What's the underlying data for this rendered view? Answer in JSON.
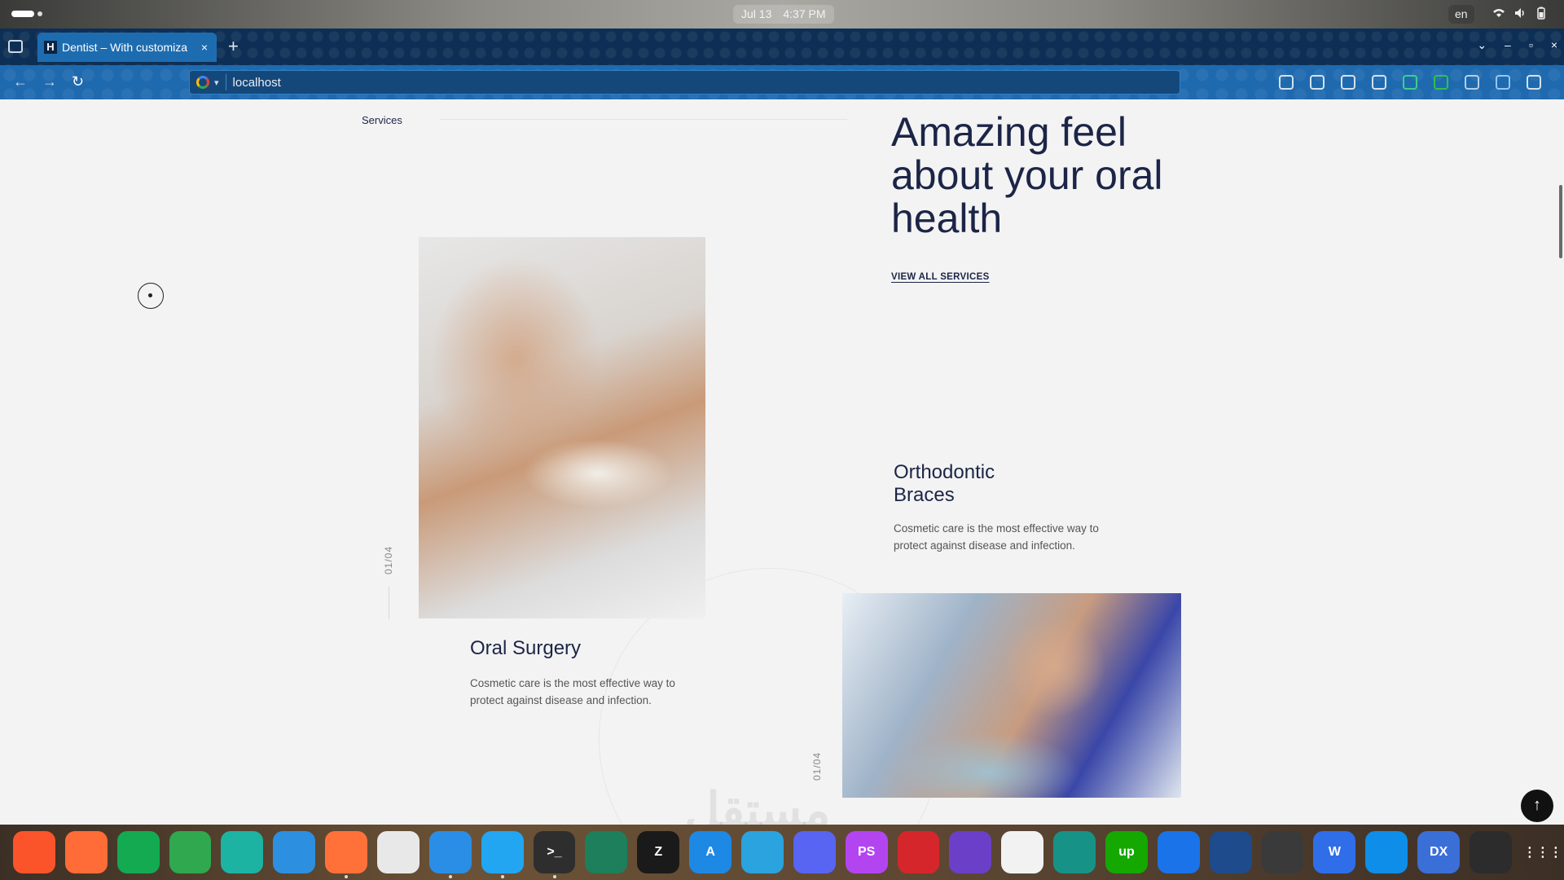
{
  "os": {
    "date": "Jul 13",
    "time": "4:37 PM",
    "language": "en",
    "tray_icons": [
      "wifi-icon",
      "volume-icon",
      "battery-icon"
    ]
  },
  "browser": {
    "tab_title": "Dentist – With customiza",
    "tab_favicon": "H",
    "tab_close": "×",
    "new_tab": "+",
    "url": "localhost",
    "back": "←",
    "forward": "→",
    "reload": "↻",
    "window_controls": {
      "minimize": "–",
      "maximize": "▫",
      "close": "×"
    },
    "tab_list": "⌄",
    "extension_colors": [
      "#e8eef5",
      "#e8eef5",
      "#e8eef5",
      "#e8eef5",
      "#3ddc84",
      "#2ecc40",
      "#c8d8e8",
      "#a0d0ff",
      "#e8eef5"
    ]
  },
  "page": {
    "breadcrumb": "Services",
    "hero_title": "Amazing feel about your oral health",
    "view_all": "VIEW ALL SERVICES",
    "services": [
      {
        "counter": "01/04",
        "title": "Oral Surgery",
        "description": "Cosmetic care is the most effective way to protect against disease and infection."
      },
      {
        "counter": "01/04",
        "title": "Orthodontic Braces",
        "description": "Cosmetic care is the most effective way to protect against disease and infection."
      }
    ],
    "back_to_top": "↑",
    "watermark": "مستقل"
  },
  "dock": {
    "apps": [
      {
        "name": "brave",
        "color": "#fb542b",
        "label": ""
      },
      {
        "name": "postman",
        "color": "#ff6c37",
        "label": ""
      },
      {
        "name": "mongodb-compass",
        "color": "#13aa52",
        "label": ""
      },
      {
        "name": "app-green",
        "color": "#2fa84f",
        "label": ""
      },
      {
        "name": "edge",
        "color": "#1db3a3",
        "label": ""
      },
      {
        "name": "firefox-dev",
        "color": "#2d8fe0",
        "label": ""
      },
      {
        "name": "firefox",
        "color": "#ff7139",
        "label": ""
      },
      {
        "name": "chrome",
        "color": "#e8e8e8",
        "label": ""
      },
      {
        "name": "files",
        "color": "#2a8ee6",
        "label": ""
      },
      {
        "name": "vscode",
        "color": "#22a6f2",
        "label": ""
      },
      {
        "name": "terminal",
        "color": "#2e2e2e",
        "label": ">_"
      },
      {
        "name": "system-monitor",
        "color": "#1d7f5b",
        "label": ""
      },
      {
        "name": "zed",
        "color": "#1a1a1a",
        "label": "Z"
      },
      {
        "name": "app-store",
        "color": "#1e88e5",
        "label": "A"
      },
      {
        "name": "telegram",
        "color": "#2aa3de",
        "label": ""
      },
      {
        "name": "discord",
        "color": "#5865f2",
        "label": ""
      },
      {
        "name": "phpstorm",
        "color": "#b345f1",
        "label": "PS"
      },
      {
        "name": "opera",
        "color": "#d5272b",
        "label": ""
      },
      {
        "name": "app-purple",
        "color": "#6c3fc8",
        "label": ""
      },
      {
        "name": "inkscape",
        "color": "#f2f2f2",
        "label": ""
      },
      {
        "name": "gitkraken",
        "color": "#179287",
        "label": ""
      },
      {
        "name": "upwork",
        "color": "#14a800",
        "label": "up"
      },
      {
        "name": "thunderbird",
        "color": "#1a73e8",
        "label": ""
      },
      {
        "name": "app-toggle",
        "color": "#1d4b8c",
        "label": ""
      },
      {
        "name": "obs",
        "color": "#3a3a3a",
        "label": ""
      },
      {
        "name": "wps-writer",
        "color": "#2f6ee8",
        "label": "W"
      },
      {
        "name": "teamviewer",
        "color": "#0e8ee9",
        "label": ""
      },
      {
        "name": "jadx",
        "color": "#3a6fd8",
        "label": "DX"
      },
      {
        "name": "figma",
        "color": "#2c2c2c",
        "label": ""
      },
      {
        "name": "app-grid",
        "color": "transparent",
        "label": "⋮⋮⋮"
      }
    ]
  }
}
